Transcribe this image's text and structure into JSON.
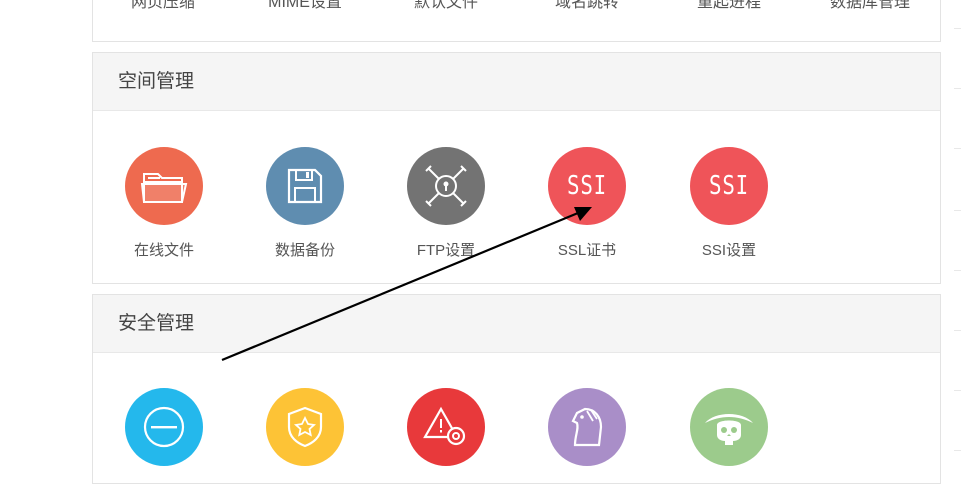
{
  "top_row": {
    "items": [
      "网页压缩",
      "MIME设置",
      "默认文件",
      "域名跳转",
      "重起进程",
      "数据库管理"
    ]
  },
  "space_panel": {
    "title": "空间管理",
    "items": [
      {
        "label": "在线文件",
        "icon": "folder-icon",
        "color": "#ee6a4f"
      },
      {
        "label": "数据备份",
        "icon": "floppy-disk-icon",
        "color": "#5f8db0"
      },
      {
        "label": "FTP设置",
        "icon": "ftp-network-icon",
        "color": "#737373"
      },
      {
        "label": "SSL证书",
        "icon": "ssl-icon",
        "color": "#ef5459",
        "icon_text": "SSI"
      },
      {
        "label": "SSI设置",
        "icon": "ssi-icon",
        "color": "#ef5459",
        "icon_text": "SSI"
      }
    ]
  },
  "security_panel": {
    "title": "安全管理",
    "items": [
      {
        "icon": "minus-circle-icon",
        "color": "#24b8ec"
      },
      {
        "icon": "shield-star-icon",
        "color": "#fdc336"
      },
      {
        "icon": "warning-gear-icon",
        "color": "#e8393b"
      },
      {
        "icon": "trojan-horse-icon",
        "color": "#a98ec8"
      },
      {
        "icon": "pirate-skull-icon",
        "color": "#9ccb8c"
      }
    ]
  }
}
